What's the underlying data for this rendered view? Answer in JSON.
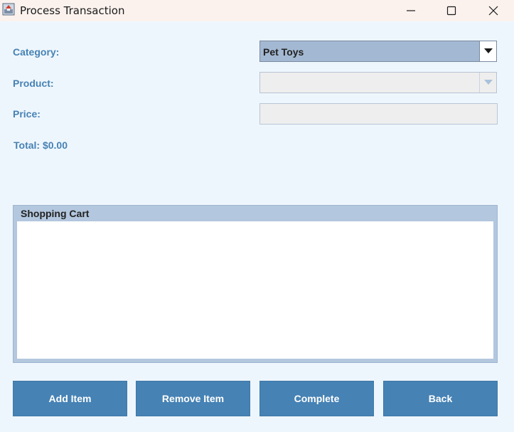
{
  "window": {
    "title": "Process Transaction"
  },
  "icons": {
    "app": "app-icon",
    "minimize": "minimize-icon",
    "maximize": "maximize-icon",
    "close": "close-icon",
    "dropdown": "chevron-down-icon"
  },
  "form": {
    "category_label": "Category:",
    "category_value": "Pet Toys",
    "product_label": "Product:",
    "product_value": "",
    "price_label": "Price:",
    "price_value": "",
    "total_label": "Total: $0.00"
  },
  "cart": {
    "title": "Shopping Cart",
    "items": []
  },
  "buttons": {
    "add": "Add Item",
    "remove": "Remove Item",
    "complete": "Complete",
    "back": "Back"
  },
  "colors": {
    "accent": "#4682b4",
    "background": "#eef6fd",
    "titlebar": "#fbf2ee",
    "selected_combo": "#a3b8d2",
    "cart_frame": "#b3c7de"
  }
}
